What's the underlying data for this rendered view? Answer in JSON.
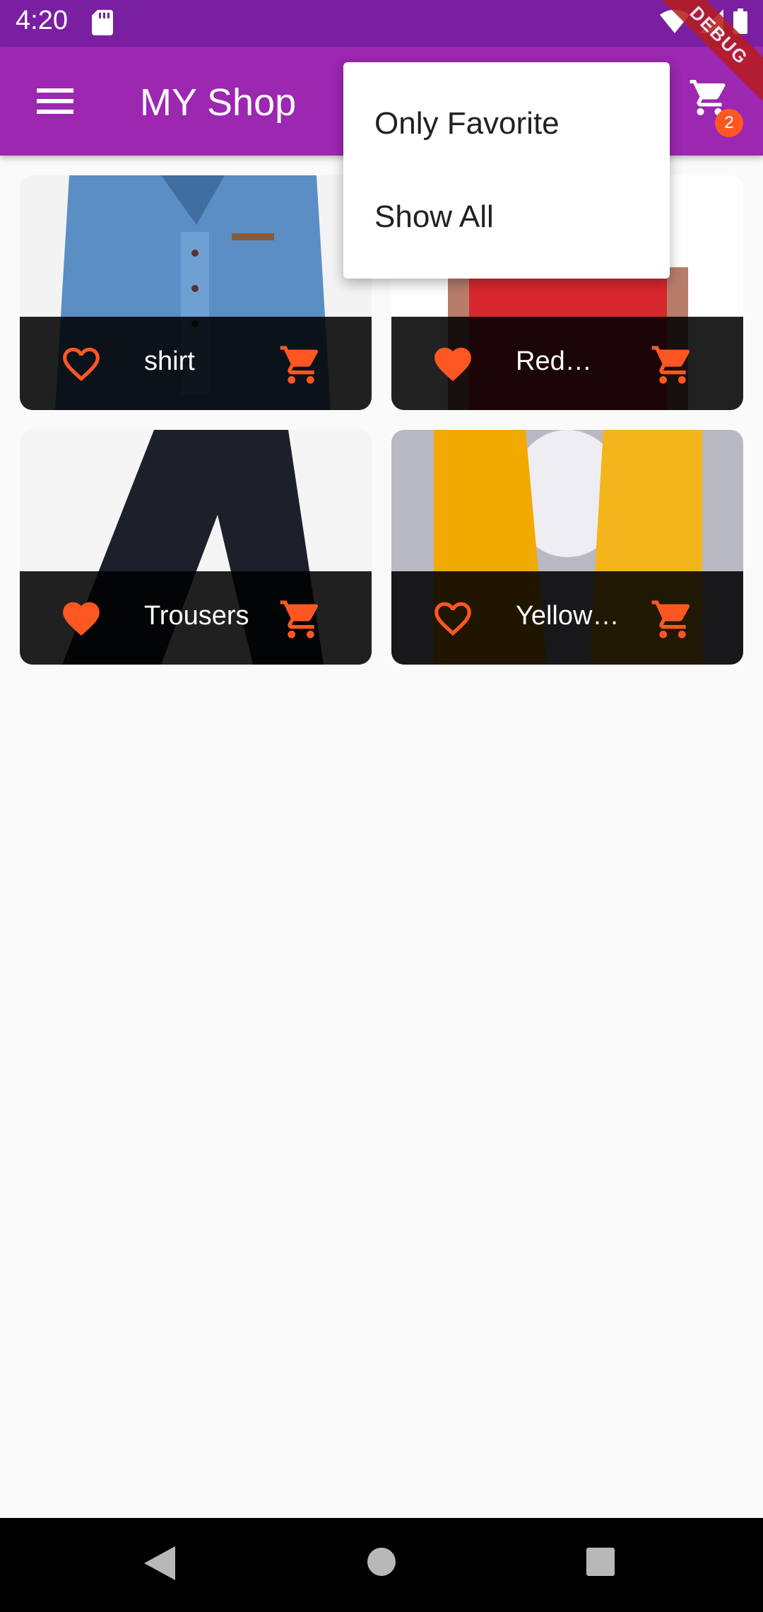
{
  "status_bar": {
    "time": "4:20"
  },
  "app_bar": {
    "title": "MY Shop",
    "cart_count": "2"
  },
  "debug_banner": "DEBUG",
  "dropdown": {
    "items": [
      "Only Favorite",
      "Show All"
    ]
  },
  "products": [
    {
      "title": "shirt",
      "favorite": false,
      "image": "blue-shirt"
    },
    {
      "title": "Red Shirt",
      "favorite": true,
      "image": "red-shirt"
    },
    {
      "title": "Trousers",
      "favorite": true,
      "image": "black-trousers"
    },
    {
      "title": "Yellow Scarf",
      "favorite": false,
      "image": "yellow-scarf"
    }
  ],
  "colors": {
    "primary": "#9c27b0",
    "primary_dark": "#7b1fa2",
    "accent": "#ff5722"
  }
}
